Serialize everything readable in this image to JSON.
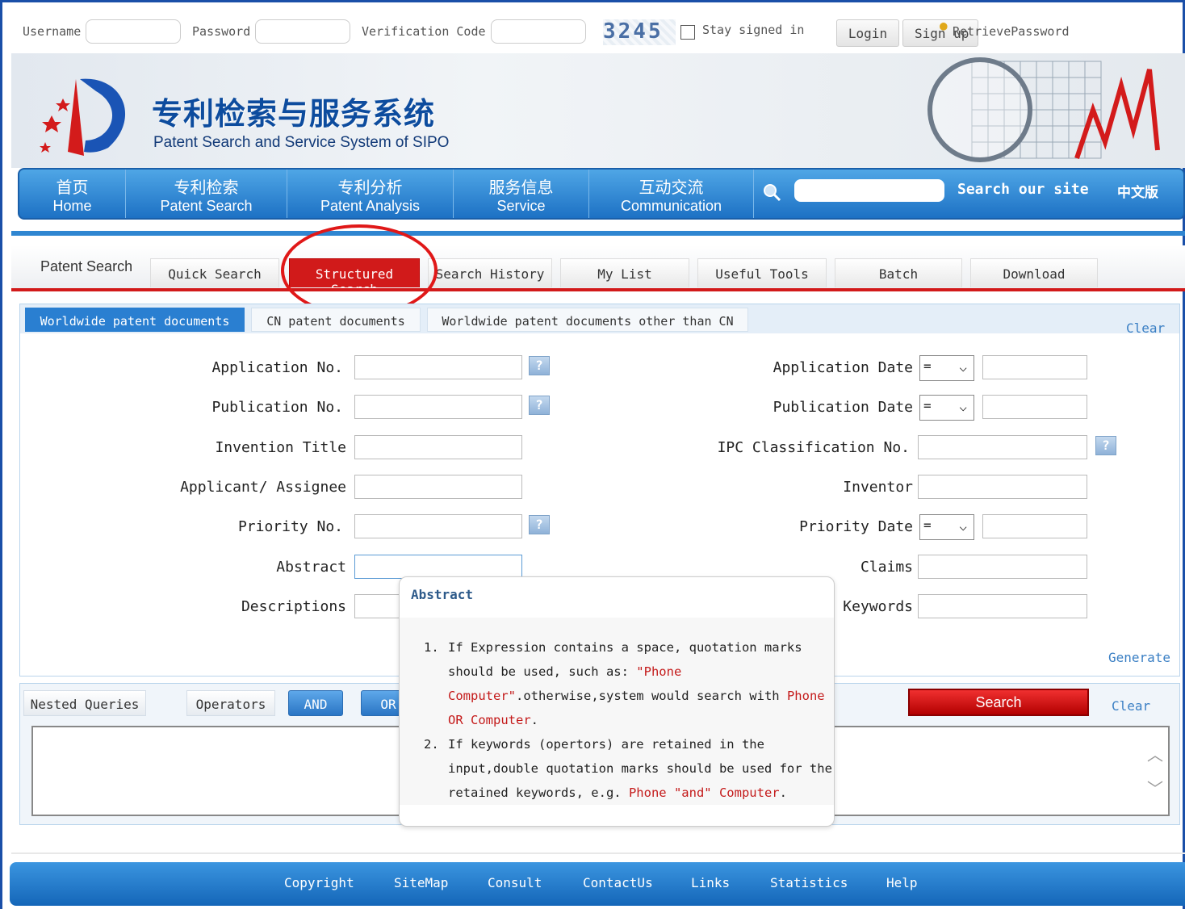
{
  "login_bar": {
    "username_label": "Username",
    "password_label": "Password",
    "verification_label": "Verification Code",
    "captcha_text": "3245",
    "stay_signed_in_label": "Stay signed in",
    "login_label": "Login",
    "signup_label": "Sign up",
    "retrieve_label": "RetrievePassword"
  },
  "banner": {
    "title_cn": "专利检索与服务系统",
    "title_en": "Patent Search and Service System of SIPO"
  },
  "nav": {
    "items": [
      {
        "cn": "首页",
        "en": "Home"
      },
      {
        "cn": "专利检索",
        "en": "Patent Search"
      },
      {
        "cn": "专利分析",
        "en": "Patent Analysis"
      },
      {
        "cn": "服务信息",
        "en": "Service"
      },
      {
        "cn": "互动交流",
        "en": "Communication"
      }
    ],
    "search_label": "Search our site",
    "lang_label": "中文版"
  },
  "tabs": {
    "section_label": "Patent Search",
    "items": [
      "Quick Search",
      "Structured Search",
      "Search History",
      "My List",
      "Useful Tools",
      "Batch",
      "Download"
    ],
    "active": "Structured Search"
  },
  "subtabs": {
    "items": [
      "Worldwide patent documents",
      "CN patent documents",
      "Worldwide patent documents other than CN"
    ],
    "active": "Worldwide patent documents",
    "clear_label": "Clear"
  },
  "form": {
    "left": [
      {
        "label": "Application No."
      },
      {
        "label": "Publication No."
      },
      {
        "label": "Invention Title"
      },
      {
        "label": "Applicant/ Assignee"
      },
      {
        "label": "Priority No."
      },
      {
        "label": "Abstract"
      },
      {
        "label": "Descriptions"
      }
    ],
    "right": [
      {
        "label": "Application Date",
        "operator": "="
      },
      {
        "label": "Publication Date",
        "operator": "="
      },
      {
        "label": "IPC Classification No."
      },
      {
        "label": "Inventor"
      },
      {
        "label": "Priority Date",
        "operator": "="
      },
      {
        "label": "Claims"
      },
      {
        "label": "Keywords"
      }
    ],
    "help_glyph": "?",
    "generate_label": "Generate"
  },
  "nested": {
    "nested_label": "Nested Queries",
    "operators_label": "Operators",
    "and_label": "AND",
    "or_label": "OR",
    "search_label": "Search",
    "clear_label": "Clear"
  },
  "popup": {
    "title": "Abstract",
    "item1_num": "1.",
    "item1_line1": "If Expression contains a space, quotation marks",
    "item1_line2a": "should be used, such as: ",
    "item1_line2b": "\"Phone",
    "item1_line3a": "Computer\"",
    "item1_line3b": ".otherwise,system would search with ",
    "item1_line3c": "Phone",
    "item1_line4a": "OR Computer",
    "item1_line4b": ".",
    "item2_num": "2.",
    "item2_line1": "If keywords (opertors) are retained in the",
    "item2_line2": "input,double quotation marks should be used for the",
    "item2_line3a": "retained keywords, e.g. ",
    "item2_line3b": "Phone \"and\" Computer",
    "item2_line3c": "."
  },
  "footer": {
    "links": [
      "Copyright",
      "SiteMap",
      "Consult",
      "ContactUs",
      "Links",
      "Statistics",
      "Help"
    ]
  },
  "colors": {
    "accent_blue": "#1d71c4",
    "active_red": "#d11a1a",
    "annotation_circle": "#e01818"
  }
}
